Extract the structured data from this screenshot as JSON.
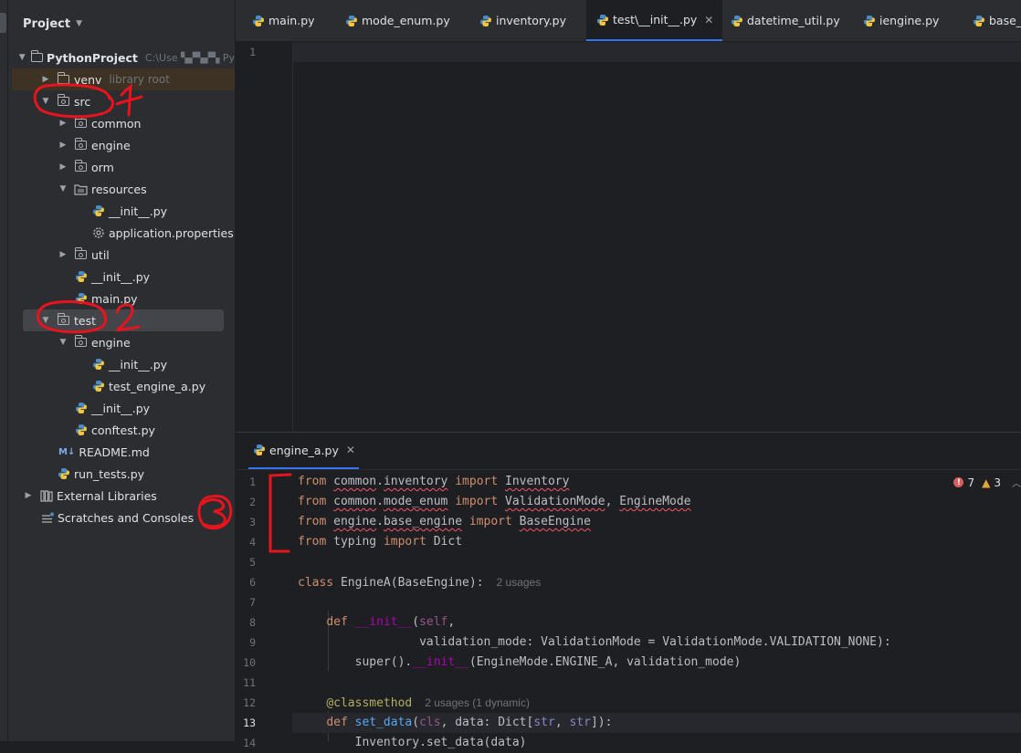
{
  "project_panel": {
    "title": "Project",
    "tree": [
      {
        "label": "PythonProject",
        "extra": "C:\\Use ▚▞▚▞▚ Py",
        "state": "expanded",
        "icon": "folder-icon",
        "level": 0
      },
      {
        "label": "venv",
        "extra": "library root",
        "state": "collapsed",
        "icon": "folder-icon",
        "level": 1
      },
      {
        "label": "src",
        "extra": "",
        "state": "expanded",
        "icon": "folder-icon",
        "level": 1
      },
      {
        "label": "common",
        "extra": "",
        "state": "collapsed",
        "icon": "folder-icon",
        "level": 2
      },
      {
        "label": "engine",
        "extra": "",
        "state": "collapsed",
        "icon": "folder-icon",
        "level": 2
      },
      {
        "label": "orm",
        "extra": "",
        "state": "collapsed",
        "icon": "folder-icon",
        "level": 2
      },
      {
        "label": "resources",
        "extra": "",
        "state": "expanded",
        "icon": "resources-folder-icon",
        "level": 2
      },
      {
        "label": "__init__.py",
        "extra": "",
        "state": "none",
        "icon": "python-file-icon",
        "level": 3
      },
      {
        "label": "application.properties",
        "extra": "",
        "state": "none",
        "icon": "settings-file-icon",
        "level": 3
      },
      {
        "label": "util",
        "extra": "",
        "state": "collapsed",
        "icon": "folder-icon",
        "level": 2
      },
      {
        "label": "__init__.py",
        "extra": "",
        "state": "none",
        "icon": "python-file-icon",
        "level": 2
      },
      {
        "label": "main.py",
        "extra": "",
        "state": "none",
        "icon": "python-file-icon",
        "level": 2
      },
      {
        "label": "test",
        "extra": "",
        "state": "expanded",
        "icon": "folder-icon",
        "level": 1
      },
      {
        "label": "engine",
        "extra": "",
        "state": "expanded",
        "icon": "folder-icon",
        "level": 2
      },
      {
        "label": "__init__.py",
        "extra": "",
        "state": "none",
        "icon": "python-file-icon",
        "level": 3
      },
      {
        "label": "test_engine_a.py",
        "extra": "",
        "state": "none",
        "icon": "python-file-icon",
        "level": 3
      },
      {
        "label": "__init__.py",
        "extra": "",
        "state": "none",
        "icon": "python-file-icon",
        "level": 2
      },
      {
        "label": "conftest.py",
        "extra": "",
        "state": "none",
        "icon": "python-file-icon",
        "level": 2
      },
      {
        "label": "README.md",
        "extra": "",
        "state": "none",
        "icon": "markdown-file-icon",
        "level": 1
      },
      {
        "label": "run_tests.py",
        "extra": "",
        "state": "none",
        "icon": "python-file-icon",
        "level": 1
      },
      {
        "label": "External Libraries",
        "extra": "",
        "state": "collapsed",
        "icon": "library-icon",
        "level": 0
      },
      {
        "label": "Scratches and Consoles",
        "extra": "",
        "state": "none",
        "icon": "scratches-icon",
        "level": 0
      }
    ]
  },
  "tabs": [
    {
      "label": "main.py",
      "active": false
    },
    {
      "label": "mode_enum.py",
      "active": false
    },
    {
      "label": "inventory.py",
      "active": false
    },
    {
      "label": "test\\__init__.py",
      "active": true
    },
    {
      "label": "datetime_util.py",
      "active": false
    },
    {
      "label": "iengine.py",
      "active": false
    },
    {
      "label": "base_e",
      "active": false
    }
  ],
  "top_editor": {
    "line_numbers": [
      "1"
    ]
  },
  "bottom_editor": {
    "tab": "engine_a.py",
    "errors": "7",
    "warnings": "3",
    "lines": [
      {
        "n": "1",
        "text": "from common.inventory import Inventory"
      },
      {
        "n": "2",
        "text": "from common.mode_enum import ValidationMode, EngineMode"
      },
      {
        "n": "3",
        "text": "from engine.base_engine import BaseEngine"
      },
      {
        "n": "4",
        "text": "from typing import Dict"
      },
      {
        "n": "5",
        "text": ""
      },
      {
        "n": "6",
        "text": "class EngineA(BaseEngine):",
        "hint": "2 usages"
      },
      {
        "n": "7",
        "text": ""
      },
      {
        "n": "8",
        "text": "    def __init__(self,"
      },
      {
        "n": "9",
        "text": "                 validation_mode: ValidationMode = ValidationMode.VALIDATION_NONE):"
      },
      {
        "n": "10",
        "text": "        super().__init__(EngineMode.ENGINE_A, validation_mode)"
      },
      {
        "n": "11",
        "text": ""
      },
      {
        "n": "12",
        "text": "    @classmethod",
        "hint": "2 usages (1 dynamic)"
      },
      {
        "n": "13",
        "text": "    def set_data(cls, data: Dict[str, str]):"
      },
      {
        "n": "14",
        "text": "        Inventory.set_data(data)"
      }
    ]
  },
  "annotations": {
    "one": "1",
    "two": "2",
    "three": "3"
  },
  "colors": {
    "annotation_red": "#e8141d",
    "accent": "#3574f0"
  }
}
